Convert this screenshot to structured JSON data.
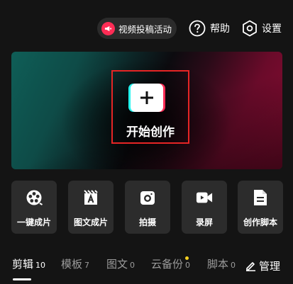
{
  "topbar": {
    "promo_label": "视频投稿活动",
    "help_label": "帮助",
    "settings_label": "设置"
  },
  "banner": {
    "start_label": "开始创作"
  },
  "tiles": [
    {
      "label": "一键成片",
      "icon": "film-reel-icon"
    },
    {
      "label": "图文成片",
      "icon": "text-to-video-icon"
    },
    {
      "label": "拍摄",
      "icon": "camera-icon"
    },
    {
      "label": "录屏",
      "icon": "screen-record-icon"
    },
    {
      "label": "创作脚本",
      "icon": "script-document-icon"
    }
  ],
  "tabs": [
    {
      "label": "剪辑",
      "count": "10",
      "active": true
    },
    {
      "label": "模板",
      "count": "7"
    },
    {
      "label": "图文",
      "count": "0"
    },
    {
      "label": "云备份",
      "count": "0",
      "has_dot": true
    },
    {
      "label": "脚本",
      "count": "0"
    }
  ],
  "manage_label": "管理",
  "colors": {
    "background": "#141414",
    "accent_red": "#fe2c55",
    "accent_cyan": "#25f4ee",
    "tile_bg": "#2c2c2c",
    "notification_dot": "#f5d020"
  }
}
